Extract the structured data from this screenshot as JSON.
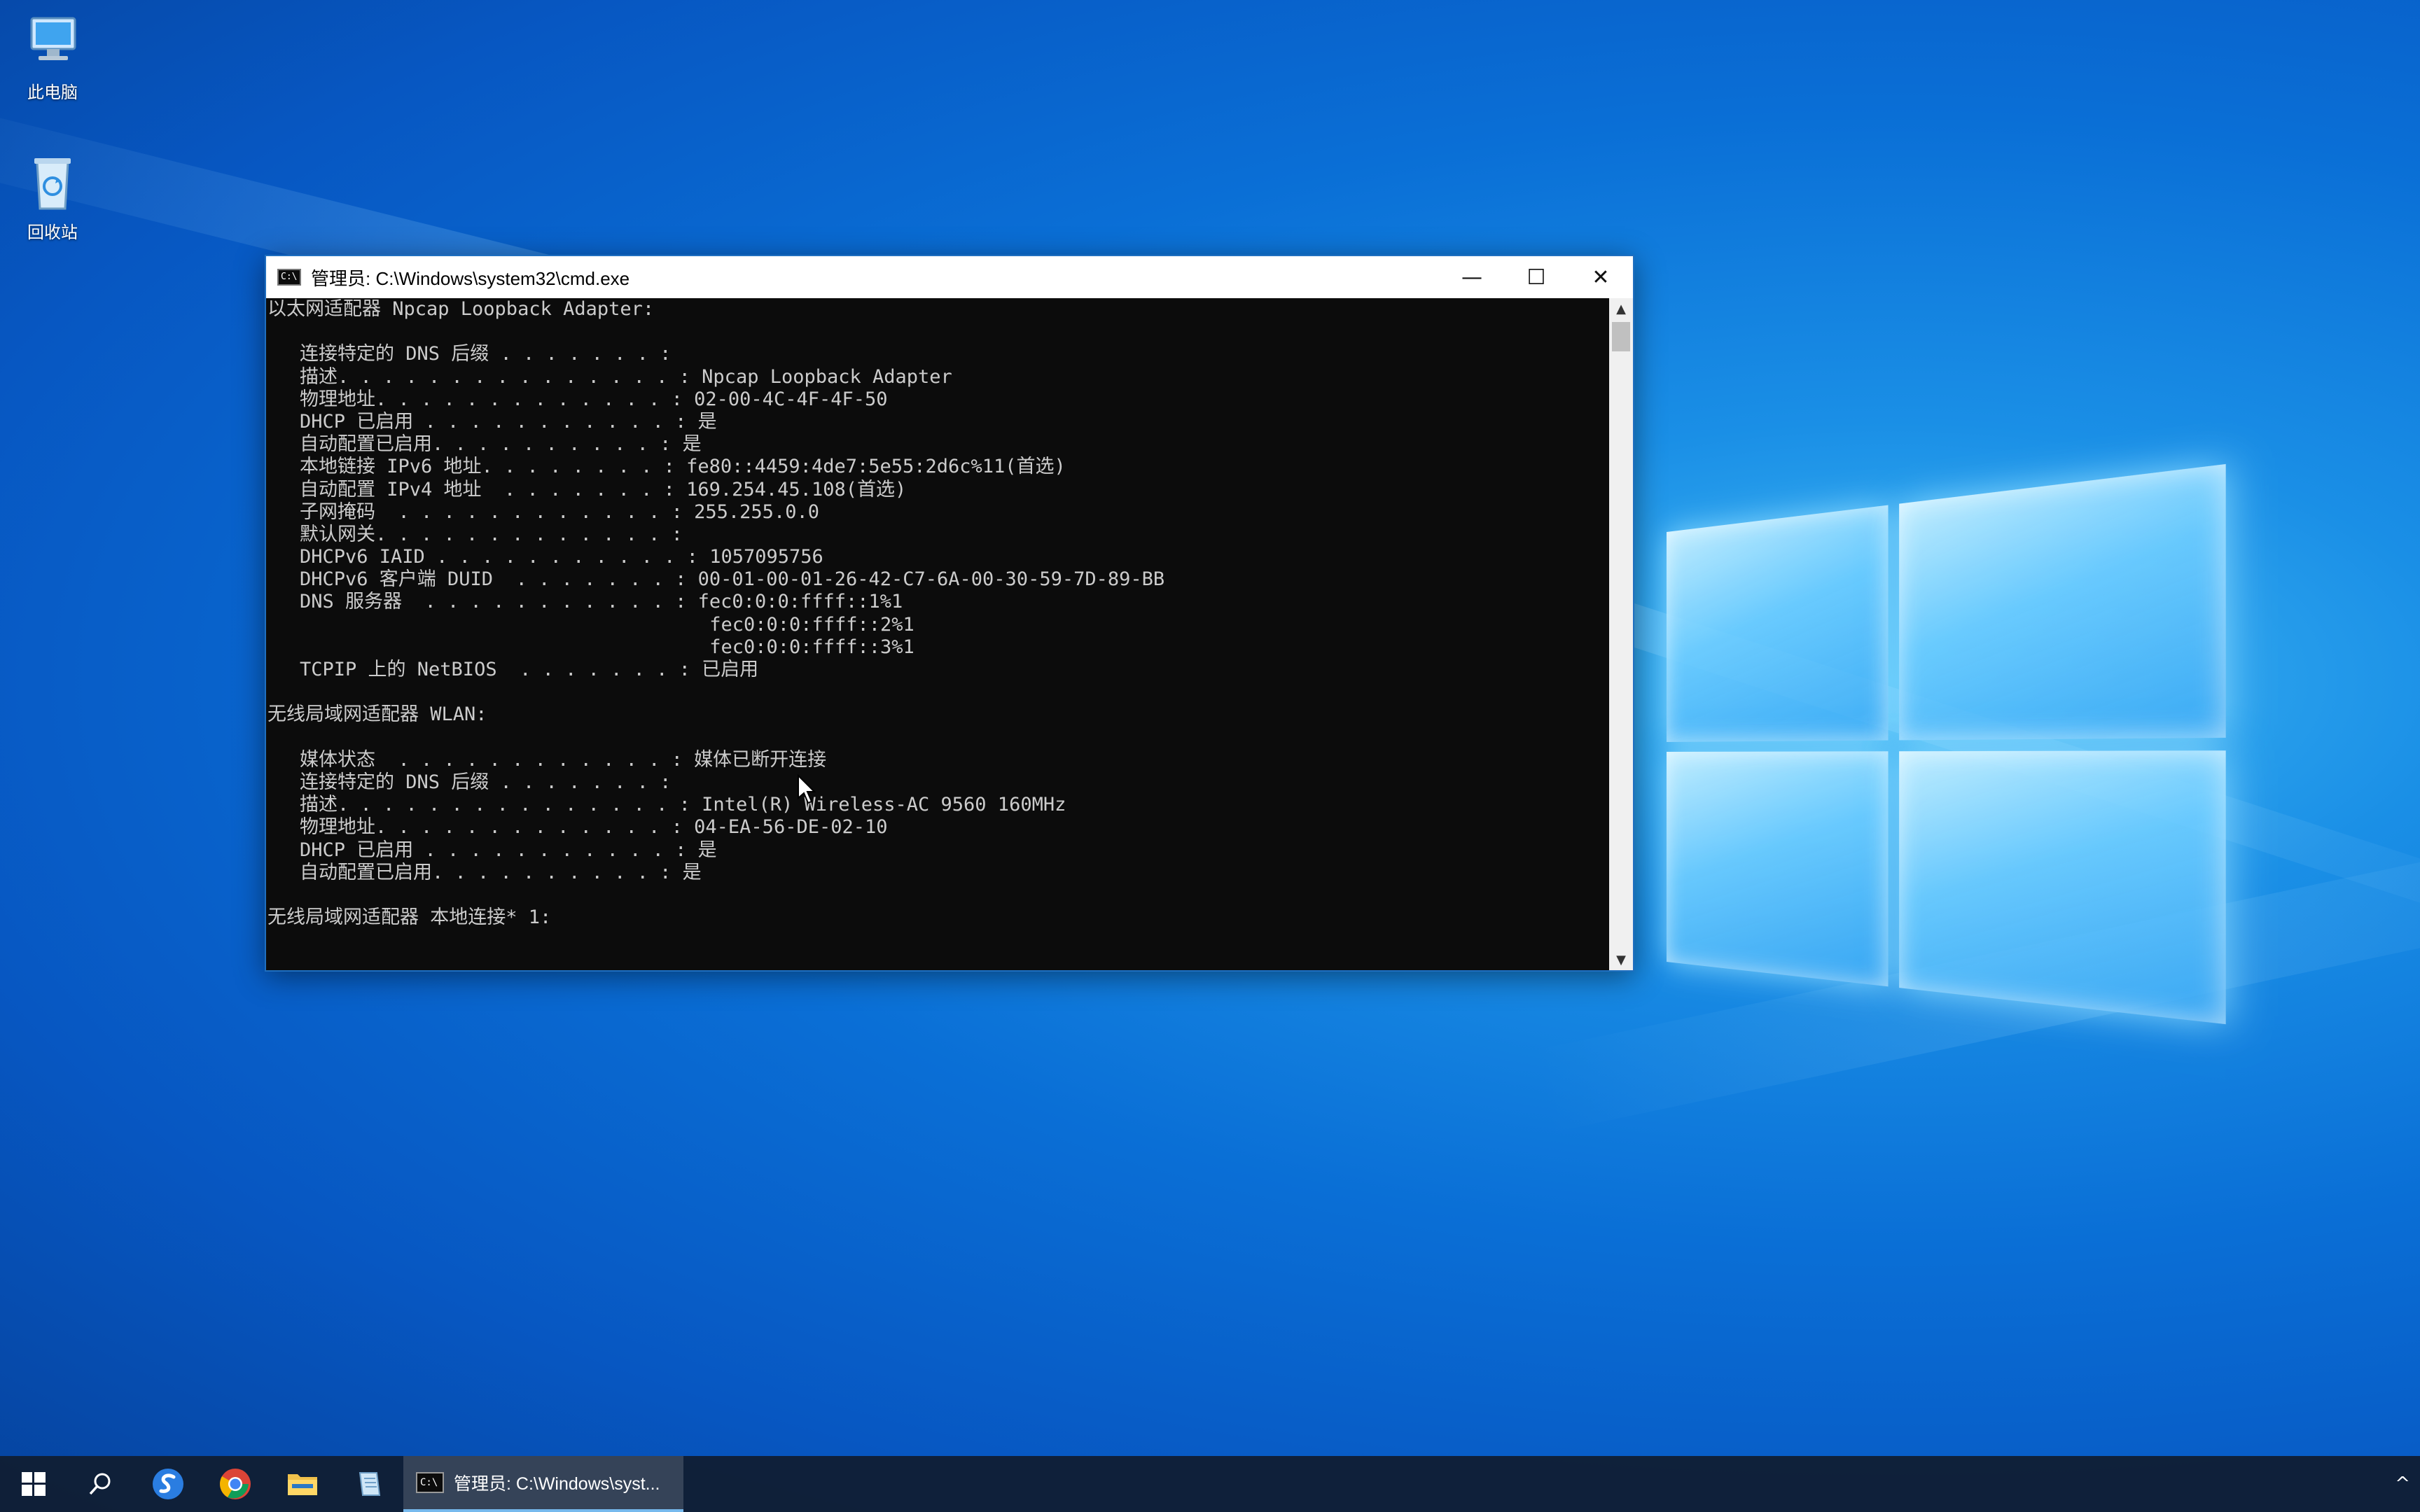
{
  "desktop": {
    "icons": [
      {
        "label": "此电脑",
        "icon": "computer-icon"
      },
      {
        "label": "回收站",
        "icon": "recycle-bin-icon"
      }
    ]
  },
  "cmd_window": {
    "title": "管理员: C:\\Windows\\system32\\cmd.exe",
    "icon_text": "C:\\",
    "controls": {
      "minimize": "—",
      "maximize": "☐",
      "close": "✕"
    },
    "lines": [
      {
        "text": "以太网适配器 Npcap Loopback Adapter:",
        "indent": false
      },
      {
        "text": "",
        "indent": false
      },
      {
        "text": "连接特定的 DNS 后缀 . . . . . . . :",
        "indent": true
      },
      {
        "text": "描述. . . . . . . . . . . . . . . : Npcap Loopback Adapter",
        "indent": true
      },
      {
        "text": "物理地址. . . . . . . . . . . . . : 02-00-4C-4F-4F-50",
        "indent": true
      },
      {
        "text": "DHCP 已启用 . . . . . . . . . . . : 是",
        "indent": true
      },
      {
        "text": "自动配置已启用. . . . . . . . . . : 是",
        "indent": true
      },
      {
        "text": "本地链接 IPv6 地址. . . . . . . . : fe80::4459:4de7:5e55:2d6c%11(首选)",
        "indent": true
      },
      {
        "text": "自动配置 IPv4 地址  . . . . . . . : 169.254.45.108(首选)",
        "indent": true
      },
      {
        "text": "子网掩码  . . . . . . . . . . . . : 255.255.0.0",
        "indent": true
      },
      {
        "text": "默认网关. . . . . . . . . . . . . :",
        "indent": true
      },
      {
        "text": "DHCPv6 IAID . . . . . . . . . . . : 1057095756",
        "indent": true
      },
      {
        "text": "DHCPv6 客户端 DUID  . . . . . . . : 00-01-00-01-26-42-C7-6A-00-30-59-7D-89-BB",
        "indent": true
      },
      {
        "text": "DNS 服务器  . . . . . . . . . . . : fec0:0:0:ffff::1%1",
        "indent": true
      },
      {
        "text": "                                    fec0:0:0:ffff::2%1",
        "indent": true
      },
      {
        "text": "                                    fec0:0:0:ffff::3%1",
        "indent": true
      },
      {
        "text": "TCPIP 上的 NetBIOS  . . . . . . . : 已启用",
        "indent": true
      },
      {
        "text": "",
        "indent": false
      },
      {
        "text": "无线局域网适配器 WLAN:",
        "indent": false
      },
      {
        "text": "",
        "indent": false
      },
      {
        "text": "媒体状态  . . . . . . . . . . . . : 媒体已断开连接",
        "indent": true
      },
      {
        "text": "连接特定的 DNS 后缀 . . . . . . . :",
        "indent": true
      },
      {
        "text": "描述. . . . . . . . . . . . . . . : Intel(R) Wireless-AC 9560 160MHz",
        "indent": true
      },
      {
        "text": "物理地址. . . . . . . . . . . . . : 04-EA-56-DE-02-10",
        "indent": true
      },
      {
        "text": "DHCP 已启用 . . . . . . . . . . . : 是",
        "indent": true
      },
      {
        "text": "自动配置已启用. . . . . . . . . . : 是",
        "indent": true
      },
      {
        "text": "",
        "indent": false
      },
      {
        "text": "无线局域网适配器 本地连接* 1:",
        "indent": false
      }
    ]
  },
  "taskbar": {
    "items": [
      {
        "name": "start-button",
        "icon": "windows-logo-icon"
      },
      {
        "name": "search-button",
        "icon": "search-icon"
      },
      {
        "name": "sogou-browser",
        "icon": "sogou-icon"
      },
      {
        "name": "chrome",
        "icon": "chrome-icon"
      },
      {
        "name": "file-explorer",
        "icon": "folder-icon"
      },
      {
        "name": "notepad-app",
        "icon": "notepad-icon"
      }
    ],
    "active_task_label": "管理员: C:\\Windows\\syst...",
    "tray_chevron": "^"
  },
  "colors": {
    "console_bg": "#0c0c0c",
    "console_fg": "#cccccc",
    "taskbar_bg": "#101e34",
    "accent": "#76b9ed"
  }
}
